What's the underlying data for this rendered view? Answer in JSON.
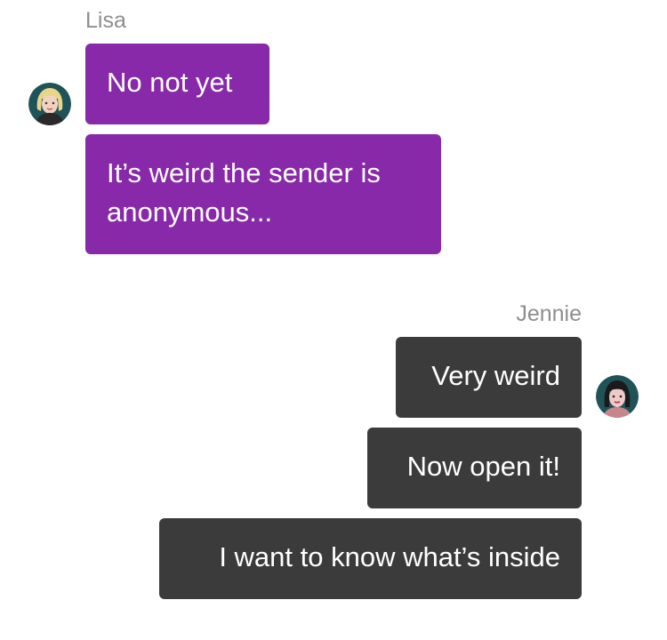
{
  "conversation": {
    "lisa": {
      "name": "Lisa",
      "avatar_icon": "blonde-woman-avatar-icon",
      "messages": [
        "No not yet",
        "It’s weird the sender is anonymous..."
      ]
    },
    "jennie": {
      "name": "Jennie",
      "avatar_icon": "dark-haired-woman-avatar-icon",
      "messages": [
        "Very weird",
        "Now open it!",
        "I want to know what’s inside"
      ]
    }
  },
  "colors": {
    "incoming_bubble": "#8829a9",
    "outgoing_bubble": "#3b3b3b",
    "sender_name": "#8e8e8e",
    "bubble_text": "#ffffff"
  }
}
